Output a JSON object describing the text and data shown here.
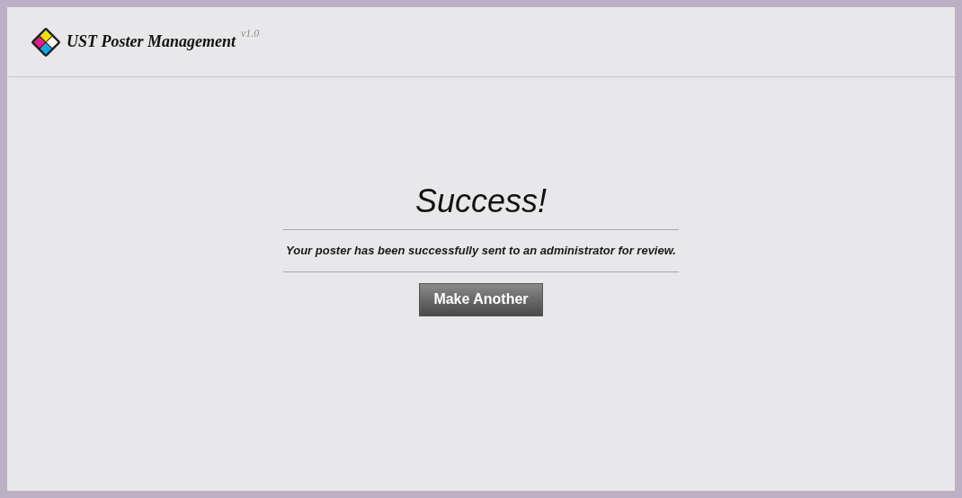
{
  "header": {
    "title": "UST Poster Management",
    "version": "v1.0"
  },
  "message": {
    "heading": "Success!",
    "text": "Your poster has been successfully sent to an administrator for review."
  },
  "button": {
    "label": "Make Another"
  }
}
